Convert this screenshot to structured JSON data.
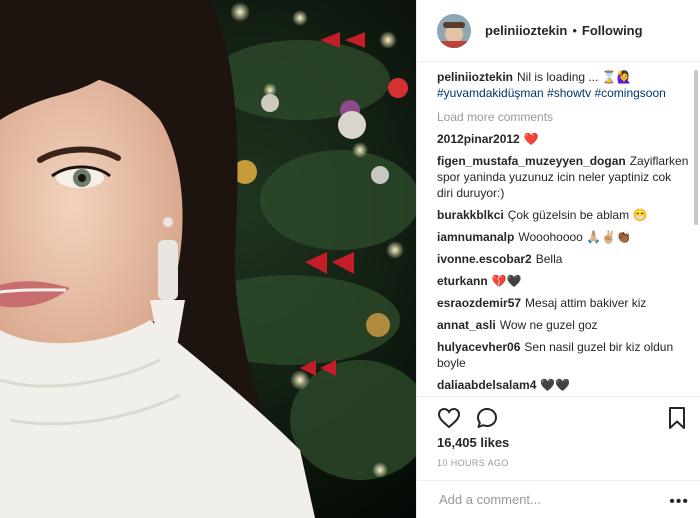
{
  "header": {
    "username": "peliniioztekin",
    "separator": "•",
    "follow_label": "Following"
  },
  "caption": {
    "username": "peliniioztekin",
    "text": "Nil is loading ... ⌛🙋‍♀️",
    "hashtags": [
      "#yuvamdakidüşman",
      "#showtv",
      "#comingsoon"
    ]
  },
  "load_more": "Load more comments",
  "comments": [
    {
      "user": "2012pinar2012",
      "text": "❤️"
    },
    {
      "user": "figen_mustafa_muzeyyen_dogan",
      "text": "Zayiflarken spor yaninda yuzunuz icin neler yaptiniz cok diri duruyor:)"
    },
    {
      "user": "burakkblkci",
      "text": "Çok güzelsin be ablam 😁"
    },
    {
      "user": "iamnumanalp",
      "text": "Wooohoooo 🙏🏼✌🏼👏🏾"
    },
    {
      "user": "ivonne.escobar2",
      "text": "Bella"
    },
    {
      "user": "eturkann",
      "text": "💔🖤"
    },
    {
      "user": "esraozdemir57",
      "text": "Mesaj attim bakiver kiz"
    },
    {
      "user": "annat_asli",
      "text": "Wow ne guzel goz"
    },
    {
      "user": "hulyacevher06",
      "text": "Sen nasil guzel bir kiz oldun boyle"
    },
    {
      "user": "daliaabdelsalam4",
      "text": "🖤🖤"
    }
  ],
  "likes": "16,405 likes",
  "timestamp": "10 HOURS AGO",
  "add_comment": {
    "placeholder": "Add a comment..."
  },
  "more_label": "•••",
  "icons": {
    "like": "heart-icon",
    "comment": "comment-bubble-icon",
    "save": "bookmark-icon",
    "more": "more-dots-icon"
  },
  "colors": {
    "text": "#262626",
    "muted": "#999999",
    "link": "#003569",
    "border": "#efefef"
  }
}
